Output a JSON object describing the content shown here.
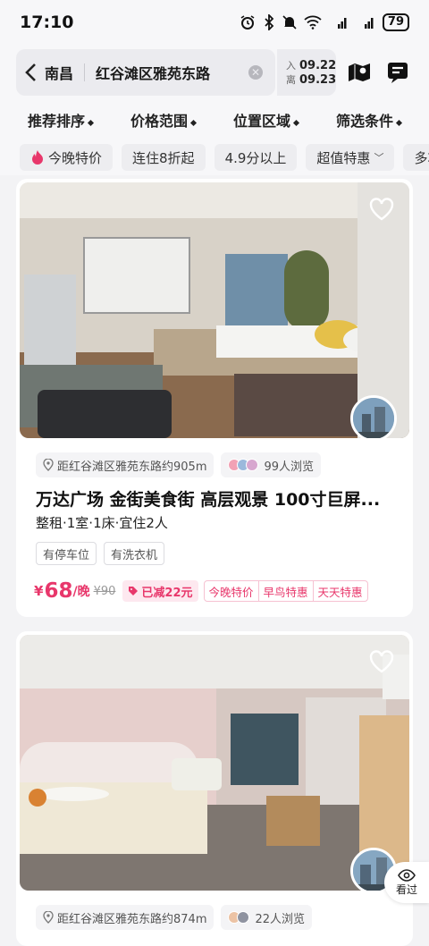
{
  "status": {
    "time": "17:10",
    "battery": "79",
    "signal1": "4G",
    "signal2": "4G"
  },
  "search": {
    "city": "南昌",
    "address": "红谷滩区雅苑东路",
    "checkin_label": "入",
    "checkin": "09.22",
    "checkout_label": "离",
    "checkout": "09.23"
  },
  "sort_bar": [
    "推荐排序",
    "价格范围",
    "位置区域",
    "筛选条件"
  ],
  "chips": [
    "今晚特价",
    "连住8折起",
    "4.9分以上",
    "超值特惠",
    "多功"
  ],
  "listings": [
    {
      "distance": "距红谷滩区雅苑东路约905m",
      "views": "99人浏览",
      "title": "万达广场  金街美食街 高层观景  100寸巨屏...",
      "subtitle": "整租·1室·1床·宜住2人",
      "facilities": [
        "有停车位",
        "有洗衣机"
      ],
      "currency": "¥",
      "price": "68",
      "per": "/晚",
      "original": "¥90",
      "discount": "已减22元",
      "promos": [
        "今晚特价",
        "早鸟特惠",
        "天天特惠"
      ]
    },
    {
      "distance": "距红谷滩区雅苑东路约874m",
      "views": "22人浏览"
    }
  ],
  "viewed_label": "看过",
  "colors": {
    "accent": "#e8376b"
  }
}
